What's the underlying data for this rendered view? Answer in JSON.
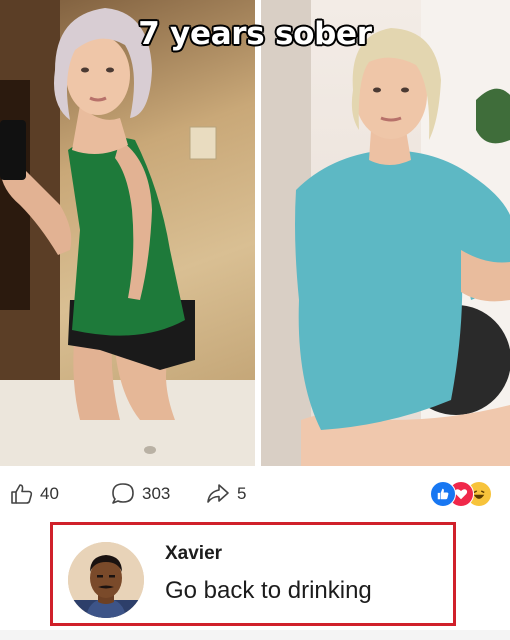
{
  "post": {
    "caption": "7 years sober",
    "images": [
      {
        "icon": "before-photo"
      },
      {
        "icon": "after-photo"
      }
    ]
  },
  "actions": {
    "likes": "40",
    "comments": "303",
    "shares": "5",
    "reactions": [
      "like-icon",
      "love-icon",
      "haha-icon"
    ]
  },
  "comment": {
    "author": "Xavier",
    "text": "Go back to drinking"
  },
  "colors": {
    "highlight_border": "#d0202a",
    "like_blue": "#1877f2",
    "love_red": "#f0284a",
    "haha_yellow": "#f7c33b"
  }
}
